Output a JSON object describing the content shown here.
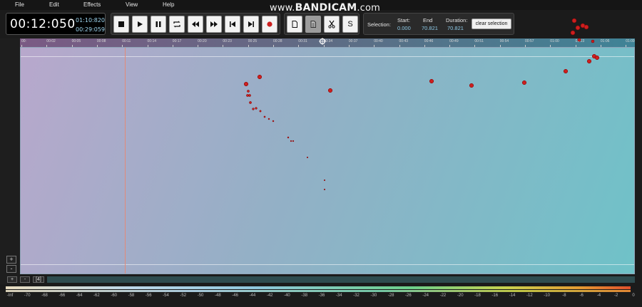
{
  "menu": [
    "File",
    "Edit",
    "Effects",
    "View",
    "Help"
  ],
  "watermark": {
    "prefix": "www.",
    "brand": "BANDICAM",
    "suffix": ".com"
  },
  "timer": {
    "current": "00:12:050",
    "total": "01:10:820",
    "remaining": "00:29:059"
  },
  "transport": {
    "buttons": [
      "stop-icon",
      "play-icon",
      "pause-icon",
      "loop-icon",
      "rewind-icon",
      "fast-forward-icon",
      "skip-start-icon",
      "skip-end-icon",
      "record-icon"
    ]
  },
  "edit_tools": {
    "buttons": [
      "copy-icon",
      "paste-icon",
      "cut-icon"
    ],
    "silence_label": "S"
  },
  "selection": {
    "label": "Selection:",
    "start_label": "Start:",
    "start_value": "0.000",
    "end_label": "End",
    "end_value": "70.821",
    "duration_label": "Duration:",
    "duration_value": "70.821",
    "clear_label": "clear selection"
  },
  "ruler_ticks": [
    "00:",
    "00:02",
    "00:05",
    "00:08",
    "00:11",
    "00:14",
    "00:17",
    "00:20",
    "00:23",
    "00:25",
    "00:28",
    "00:31",
    "00:34",
    "00:37",
    "00:40",
    "00:43",
    "00:46",
    "00:49",
    "00:51",
    "00:54",
    "00:57",
    "01:00",
    "01:03",
    "01:06",
    "01:09"
  ],
  "zoom": {
    "in": "+",
    "out": "-"
  },
  "scroll_controls": {
    "plus": "+",
    "minus": "-",
    "fit": "[4]"
  },
  "meter_scale": [
    "-Inf",
    "-70",
    "-68",
    "-66",
    "-64",
    "-62",
    "-60",
    "-58",
    "-56",
    "-54",
    "-52",
    "-50",
    "-48",
    "-46",
    "-44",
    "-42",
    "-40",
    "-38",
    "-36",
    "-34",
    "-32",
    "-30",
    "-28",
    "-26",
    "-24",
    "-22",
    "-20",
    "-18",
    "-16",
    "-14",
    "-12",
    "-10",
    "-8",
    "-6",
    "-4",
    "-2",
    "0"
  ],
  "colors": {
    "marker": "#cc1f1f",
    "cursor": "#e28a78",
    "meter_hot": "#e0502c"
  }
}
